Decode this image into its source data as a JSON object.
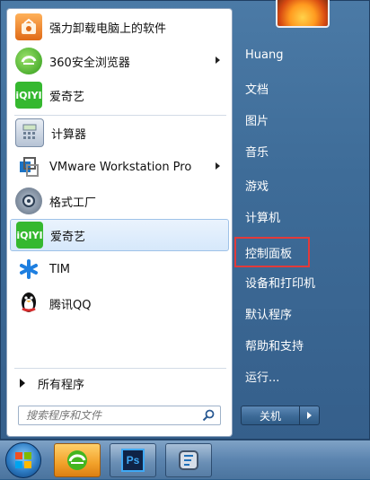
{
  "left_items": [
    {
      "label": "强力卸载电脑上的软件",
      "icon": "uninstall-icon",
      "submenu": false,
      "selected": false
    },
    {
      "label": "360安全浏览器",
      "icon": "browser-360-icon",
      "submenu": true,
      "selected": false
    },
    {
      "label": "爱奇艺",
      "icon": "iqiyi-icon",
      "submenu": false,
      "selected": false
    },
    {
      "label": "计算器",
      "icon": "calculator-icon",
      "submenu": false,
      "selected": false
    },
    {
      "label": "VMware Workstation Pro",
      "icon": "vmware-icon",
      "submenu": true,
      "selected": false
    },
    {
      "label": "格式工厂",
      "icon": "format-factory-icon",
      "submenu": false,
      "selected": false
    },
    {
      "label": "爱奇艺",
      "icon": "iqiyi-icon",
      "submenu": false,
      "selected": true
    },
    {
      "label": "TIM",
      "icon": "tim-icon",
      "submenu": false,
      "selected": false
    },
    {
      "label": "腾讯QQ",
      "icon": "qq-penguin-icon",
      "submenu": false,
      "selected": false
    }
  ],
  "all_programs": "所有程序",
  "search": {
    "placeholder": "搜索程序和文件"
  },
  "right_items": [
    "Huang",
    "文档",
    "图片",
    "音乐",
    "游戏",
    "计算机",
    "控制面板",
    "设备和打印机",
    "默认程序",
    "帮助和支持",
    "运行..."
  ],
  "highlighted_item": "控制面板",
  "shutdown_label": "关机",
  "taskbar_apps": [
    "360-browser-icon",
    "photoshop-icon",
    "format-factory-icon"
  ],
  "photoshop_text": "Ps",
  "colors": {
    "highlight": "#e23a3a",
    "selection_bg": "#d6e8fb",
    "menu_right_bg": "#3e6c98"
  }
}
